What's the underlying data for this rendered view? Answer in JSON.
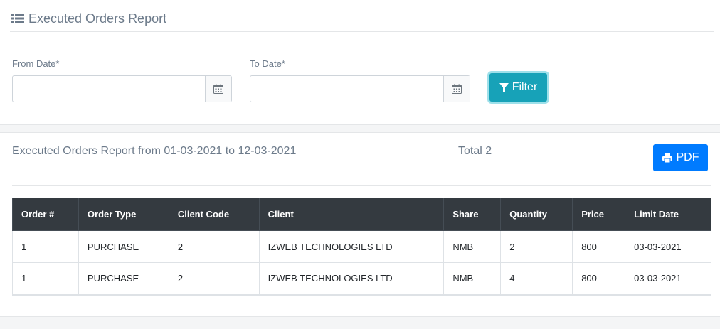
{
  "header": {
    "title": "Executed Orders Report",
    "icon": "list-icon"
  },
  "filters": {
    "from_label": "From Date*",
    "from_value": "",
    "to_label": "To Date*",
    "to_value": "",
    "filter_label": "Filter"
  },
  "report": {
    "subtitle": "Executed Orders Report from 01-03-2021 to 12-03-2021",
    "total": "Total 2",
    "pdf_label": "PDF"
  },
  "table": {
    "columns": [
      "Order #",
      "Order Type",
      "Client Code",
      "Client",
      "Share",
      "Quantity",
      "Price",
      "Limit Date"
    ],
    "rows": [
      [
        "1",
        "PURCHASE",
        "2",
        "IZWEB TECHNOLOGIES LTD",
        "NMB",
        "2",
        "800",
        "03-03-2021"
      ],
      [
        "1",
        "PURCHASE",
        "2",
        "IZWEB TECHNOLOGIES LTD",
        "NMB",
        "4",
        "800",
        "03-03-2021"
      ]
    ]
  },
  "colors": {
    "filter_button": "#17a2b8",
    "pdf_button": "#007bff",
    "table_header": "#343a40",
    "muted_text": "#6c7a8a"
  }
}
